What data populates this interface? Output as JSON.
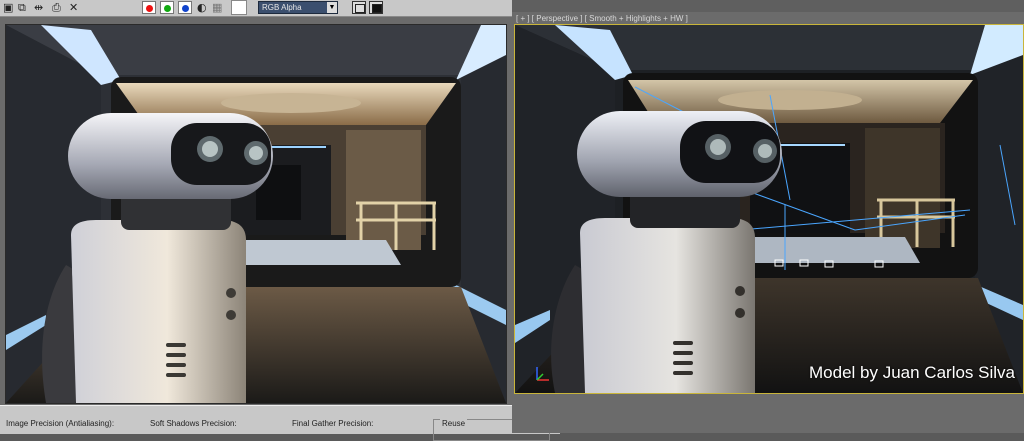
{
  "rendered_frame": {
    "toolbar": {
      "icons": [
        "save-icon",
        "clone-icon",
        "compare-icon",
        "print-icon",
        "clear-icon"
      ],
      "color_channels": [
        {
          "name": "red",
          "color": "#e11"
        },
        {
          "name": "green",
          "color": "#1a1"
        },
        {
          "name": "blue",
          "color": "#14c"
        }
      ],
      "channel_display": "RGB Alpha"
    },
    "params": {
      "image_precision_label": "Image Precision (Antialiasing):",
      "soft_shadows_label": "Soft Shadows Precision:",
      "final_gather_label": "Final Gather Precision:",
      "reuse_label": "Reuse"
    }
  },
  "viewport": {
    "label": "[ + ] [ Perspective ] [ Smooth + Highlights + HW ]",
    "watermark": "Model by Juan Carlos Silva"
  },
  "colors": {
    "viewport_border": "#c9b53a",
    "wire_blue": "#4aa6ff"
  }
}
